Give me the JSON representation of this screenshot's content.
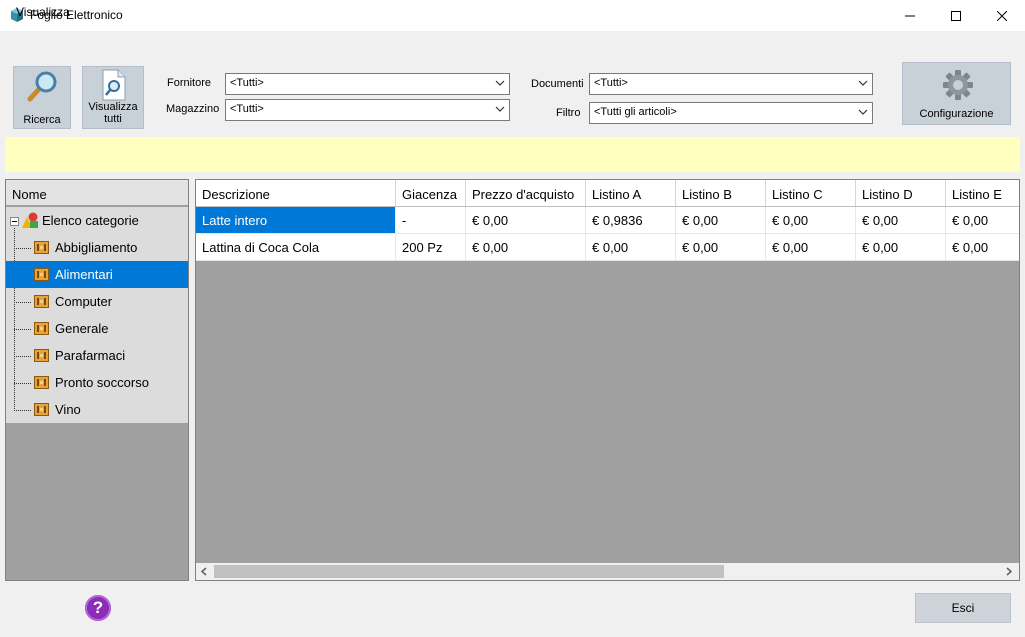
{
  "window": {
    "title": "Foglio Elettronico"
  },
  "menu": {
    "items": [
      "Visualizza"
    ]
  },
  "toolbar": {
    "search_label": "Ricerca",
    "show_all_label_line1": "Visualizza",
    "show_all_label_line2": "tutti",
    "config_label": "Configurazione"
  },
  "filters": {
    "fornitore": {
      "label": "Fornitore",
      "value": "<Tutti>"
    },
    "magazzino": {
      "label": "Magazzino",
      "value": "<Tutti>"
    },
    "documenti": {
      "label": "Documenti",
      "value": "<Tutti>"
    },
    "filtro": {
      "label": "Filtro",
      "value": "<Tutti gli articoli>"
    }
  },
  "tree": {
    "header": "Nome",
    "root": "Elenco categorie",
    "items": [
      "Abbigliamento",
      "Alimentari",
      "Computer",
      "Generale",
      "Parafarmaci",
      "Pronto soccorso",
      "Vino"
    ],
    "selected": "Alimentari"
  },
  "grid": {
    "columns": [
      "Descrizione",
      "Giacenza",
      "Prezzo d'acquisto",
      "Listino A",
      "Listino B",
      "Listino C",
      "Listino D",
      "Listino E"
    ],
    "rows": [
      [
        "Latte intero",
        "-",
        "€ 0,00",
        "€ 0,9836",
        "€ 0,00",
        "€ 0,00",
        "€ 0,00",
        "€ 0,00"
      ],
      [
        "Lattina di Coca Cola",
        "200 Pz",
        "€ 0,00",
        "€ 0,00",
        "€ 0,00",
        "€ 0,00",
        "€ 0,00",
        "€ 0,00"
      ]
    ]
  },
  "footer": {
    "exit_label": "Esci",
    "help_glyph": "?"
  },
  "colors": {
    "selection": "#0078d7",
    "info_bar": "#ffffc0",
    "grid_background": "#a0a0a0"
  }
}
